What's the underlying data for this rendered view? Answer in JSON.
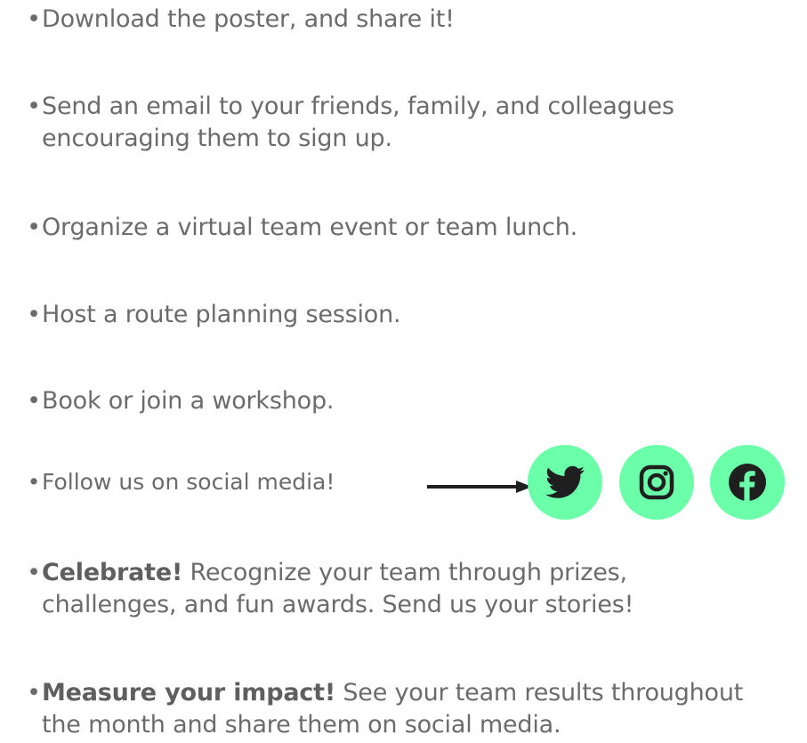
{
  "items": [
    {
      "bullet": "•",
      "text": "Download the poster, and share it!"
    },
    {
      "bullet": "•",
      "line1": "Send an email to your friends, family, and colleagues",
      "line2": "encouraging them to sign up."
    },
    {
      "bullet": "•",
      "text": "Organize a virtual team event or team lunch."
    },
    {
      "bullet": "•",
      "text": "Host a route planning session."
    },
    {
      "bullet": "•",
      "text": "Book or join a workshop."
    }
  ],
  "follow": {
    "bullet": "•",
    "text": "Follow us on social media!",
    "arrow_icon": "right-arrow-icon",
    "social": [
      {
        "name": "Twitter",
        "icon": "twitter-icon"
      },
      {
        "name": "Instagram",
        "icon": "instagram-icon"
      },
      {
        "name": "Facebook",
        "icon": "facebook-icon"
      }
    ]
  },
  "celebrate": {
    "bullet": "•",
    "strong": "Celebrate!",
    "line1_rest": " Recognize your team through prizes,",
    "line2": "challenges, and fun awards. Send us your stories!"
  },
  "measure": {
    "bullet": "•",
    "strong": "Measure your impact!",
    "line1_rest": " See your team results throughout",
    "line2": "the month and share them on social media."
  },
  "colors": {
    "text": "#6b6b6b",
    "accent_green": "#6bffaa",
    "icon_dark": "#1f1f1f"
  }
}
